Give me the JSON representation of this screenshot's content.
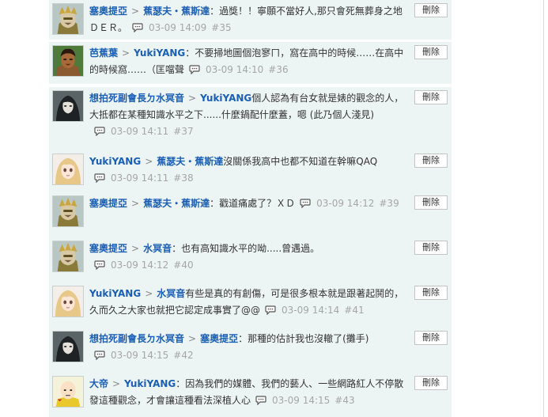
{
  "comments": [
    {
      "author": "塞奧提亞",
      "target": "蕉瑟夫・蕉斯達",
      "message": "：過獎！！寧願不當好人,那只會死無葬身之地ＤＥＲ。",
      "date": "03-09 14:09",
      "floor": "#35",
      "delete_label": "刪除",
      "avatar": "armored-knight-avatar"
    },
    {
      "author": "芭蕉葉",
      "target": "YukiYANG",
      "message": "：不要掃地圖個泡寥ㄇ，窩在高中的時候……在高中的時候窩……（匡噹聲",
      "date": "03-09 14:10",
      "floor": "#36",
      "delete_label": "刪除",
      "avatar": "muscular-man-avatar"
    },
    {
      "author": "想拍死副會長ㄉ水冥音",
      "target": "YukiYANG",
      "message": "個人認為有台女就是婊的觀念的人，大抵都在某種知識水平之下......什麼鍋配什麼蓋，嗯 (此乃個人淺見)",
      "date": "03-09 14:11",
      "floor": "#37",
      "delete_label": "刪除",
      "avatar": "dark-hair-girl-avatar"
    },
    {
      "author": "YukiYANG",
      "target": "蕉瑟夫・蕉斯達",
      "message": "沒關係我高中也都不知道在幹嘛QAQ",
      "date": "03-09 14:11",
      "floor": "#38",
      "delete_label": "刪除",
      "avatar": "blonde-anime-girl-avatar"
    },
    {
      "author": "塞奧提亞",
      "target": "蕉瑟夫・蕉斯達",
      "message": "：戳道痛處了？ＸＤ",
      "date": "03-09 14:12",
      "floor": "#39",
      "delete_label": "刪除",
      "avatar": "armored-knight-avatar"
    },
    {
      "author": "塞奧提亞",
      "target": "水冥音",
      "message": "：也有高知識水平的呦.....曾遇過。",
      "date": "03-09 14:12",
      "floor": "#40",
      "delete_label": "刪除",
      "avatar": "armored-knight-avatar"
    },
    {
      "author": "YukiYANG",
      "target": "水冥音",
      "message": "有些是真的有創傷，可是很多根本就是跟著起鬨的，久而久之大家也就把它認定成事實了@@",
      "date": "03-09 14:14",
      "floor": "#41",
      "delete_label": "刪除",
      "avatar": "blonde-anime-girl-avatar"
    },
    {
      "author": "想拍死副會長ㄉ水冥音",
      "target": "塞奧提亞",
      "message": "：那種的估計我也沒轍了(攤手)",
      "date": "03-09 14:15",
      "floor": "#42",
      "delete_label": "刪除",
      "avatar": "dark-hair-girl-avatar"
    },
    {
      "author": "大帝",
      "target": "YukiYANG",
      "message": "：因為我們的媒體、我們的藝人、一些網路紅人不停散發這種觀念，才會讓這種看法深植人心",
      "date": "03-09 14:15",
      "floor": "#43",
      "delete_label": "刪除",
      "avatar": "bald-hero-avatar"
    }
  ],
  "colors": {
    "link": "#1a5fb4",
    "meta": "#a6a6a6",
    "row_bg": "#edf4f4"
  }
}
